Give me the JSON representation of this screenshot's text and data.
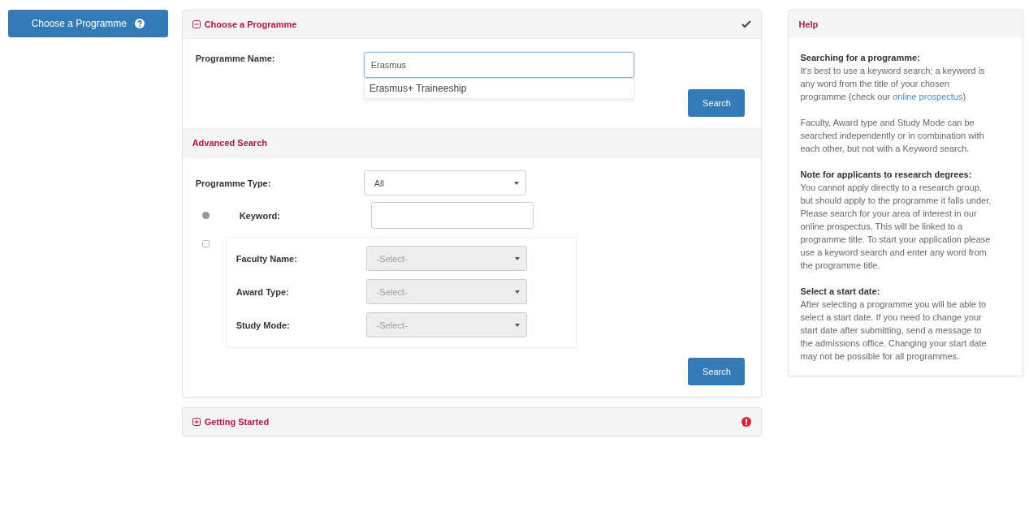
{
  "side_button": {
    "label": "Choose a Programme"
  },
  "choose_panel": {
    "title": "Choose a Programme",
    "expanded": true,
    "completed": true,
    "programme_name": {
      "label": "Programme Name:",
      "value": "Erasmus",
      "suggestions": [
        "Erasmus+ Traineeship"
      ]
    },
    "search_button": "Search"
  },
  "advanced_search": {
    "title": "Advanced Search",
    "programme_type": {
      "label": "Programme Type:",
      "value": "All",
      "disabled": false
    },
    "options": [
      {
        "kind": "radio",
        "selected": true,
        "label": "Keyword:"
      },
      {
        "kind": "group",
        "selected": false,
        "fields": [
          {
            "label": "Faculty Name:",
            "value": "-Select-",
            "disabled": true
          },
          {
            "label": "Award Type:",
            "value": "-Select-",
            "disabled": true
          },
          {
            "label": "Study Mode:",
            "value": "-Select-",
            "disabled": true
          }
        ]
      }
    ],
    "search_button": "Search"
  },
  "getting_started": {
    "title": "Getting Started",
    "expanded": false,
    "completed": false
  },
  "help": {
    "title": "Help",
    "sections": [
      {
        "heading": "Searching for a programme:",
        "text": "It's best to use a keyword search; a keyword is any word from the title of your chosen programme (check our ",
        "link": "online prospectus",
        "after": ")"
      },
      {
        "text": "Faculty, Award type and Study Mode can be searched independently or in combination with each other, but not with a Keyword search."
      },
      {
        "heading": "Note for applicants to research degrees:",
        "text": "You cannot apply directly to a research group, but should apply to the programme it falls under. Please search for your area of interest in our online prospectus. This will be linked to a programme title. To start your application please use a keyword search and enter any word from the programme title."
      },
      {
        "heading": "Select a start date:",
        "text": "After selecting a programme you will be able to select a start date. If you need to change your start date after submitting, send a message to the admissions office. Changing your start date may not be possible for all programmes."
      }
    ]
  }
}
